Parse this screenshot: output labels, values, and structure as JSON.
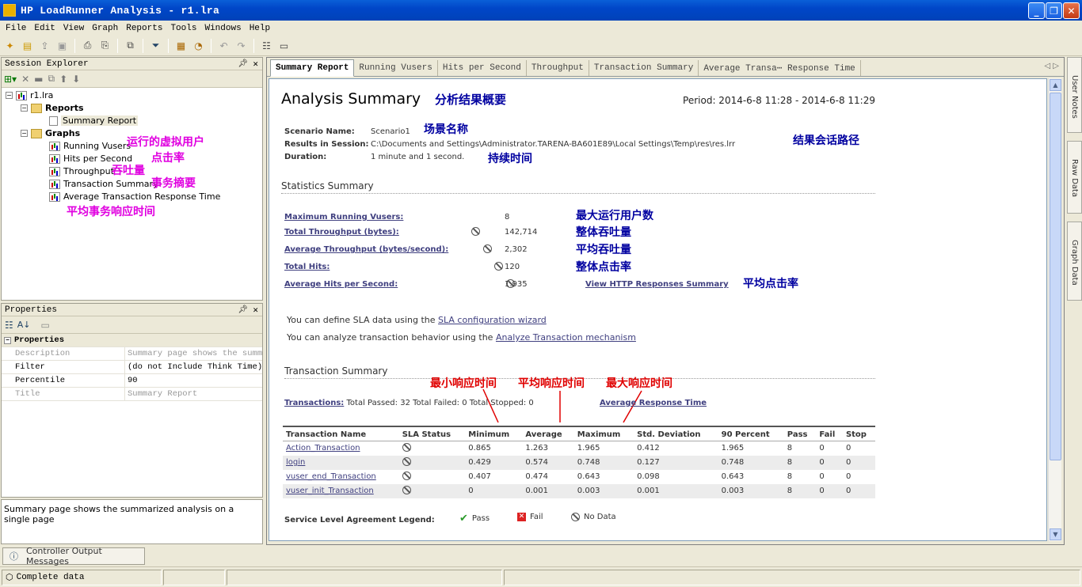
{
  "window": {
    "title": "HP LoadRunner Analysis - r1.lra"
  },
  "menu": [
    "File",
    "Edit",
    "View",
    "Graph",
    "Reports",
    "Tools",
    "Windows",
    "Help"
  ],
  "session_explorer": {
    "header": "Session Explorer",
    "root": "r1.lra",
    "reports_folder": "Reports",
    "summary_report": "Summary Report",
    "graphs_folder": "Graphs",
    "graphs": [
      "Running Vusers",
      "Hits per Second",
      "Throughput",
      "Transaction Summary",
      "Average Transaction Response Time"
    ]
  },
  "annotations_left": {
    "running_vusers": "运行的虚拟用户",
    "hits_per_second": "点击率",
    "throughput": "吞吐量",
    "transaction_summary": "事务摘要",
    "avg_response": "平均事务响应时间"
  },
  "properties": {
    "header": "Properties",
    "section": "Properties",
    "rows": [
      {
        "key": "Description",
        "value": "Summary page shows the summarized analysis on a single page",
        "disabled": true
      },
      {
        "key": "Filter",
        "value": "(do not Include Think Time)",
        "disabled": false
      },
      {
        "key": "Percentile",
        "value": "90",
        "disabled": false
      },
      {
        "key": "Title",
        "value": "Summary Report",
        "disabled": true
      }
    ],
    "description_text": "Summary page shows the summarized analysis on a single page"
  },
  "tabs": [
    "Summary Report",
    "Running Vusers",
    "Hits per Second",
    "Throughput",
    "Transaction Summary",
    "Average Transa⋯ Response Time"
  ],
  "report": {
    "title": "Analysis Summary",
    "title_annotation": "分析结果概要",
    "period": "Period: 2014-6-8 11:28 - 2014-6-8 11:29",
    "scenario_label": "Scenario Name:",
    "scenario_value": "Scenario1",
    "scenario_annotation": "场景名称",
    "results_label": "Results in Session:",
    "results_value": "C:\\Documents and Settings\\Administrator.TARENA-BA601E89\\Local Settings\\Temp\\res\\res.lrr",
    "results_annotation": "结果会话路径",
    "duration_label": "Duration:",
    "duration_value": "1 minute and 1 second.",
    "duration_annotation": "持续时间",
    "stats_title": "Statistics Summary",
    "stats": [
      {
        "label": "Maximum Running Vusers:",
        "value": "8",
        "annotation": "最大运行用户数"
      },
      {
        "label": "Total Throughput (bytes):",
        "value": "142,714",
        "annotation": "整体吞吐量"
      },
      {
        "label": "Average Throughput (bytes/second):",
        "value": "2,302",
        "annotation": "平均吞吐量"
      },
      {
        "label": "Total Hits:",
        "value": "120",
        "annotation": "整体点击率"
      },
      {
        "label": "Average Hits per Second:",
        "value": "1.935",
        "annotation": ""
      }
    ],
    "http_link": "View HTTP Responses Summary",
    "http_annotation": "平均点击率",
    "sla_text_1": "You can define SLA data using the ",
    "sla_link": "SLA configuration wizard",
    "analyze_text": "You can analyze transaction behavior using the ",
    "analyze_link": "Analyze Transaction mechanism",
    "tx_title": "Transaction Summary",
    "tx_annotations": {
      "min": "最小响应时间",
      "avg": "平均响应时间",
      "max": "最大响应时间"
    },
    "tx_link": "Transactions:",
    "tx_counts": " Total Passed: 32 Total Failed: 0 Total Stopped: 0",
    "avg_resp_link": "Average Response Time",
    "columns": [
      "Transaction Name",
      "SLA Status",
      "Minimum",
      "Average",
      "Maximum",
      "Std. Deviation",
      "90 Percent",
      "Pass",
      "Fail",
      "Stop"
    ],
    "rows": [
      [
        "Action_Transaction",
        "0.865",
        "1.263",
        "1.965",
        "0.412",
        "1.965",
        "8",
        "0",
        "0"
      ],
      [
        "login",
        "0.429",
        "0.574",
        "0.748",
        "0.127",
        "0.748",
        "8",
        "0",
        "0"
      ],
      [
        "vuser_end_Transaction",
        "0.407",
        "0.474",
        "0.643",
        "0.098",
        "0.643",
        "8",
        "0",
        "0"
      ],
      [
        "vuser_init_Transaction",
        "0",
        "0.001",
        "0.003",
        "0.001",
        "0.003",
        "8",
        "0",
        "0"
      ]
    ],
    "legend_label": "Service Level Agreement Legend:",
    "legend_pass": "Pass",
    "legend_fail": "Fail",
    "legend_nodata": "No Data"
  },
  "right_tabs": [
    "User Notes",
    "Raw Data",
    "Graph Data"
  ],
  "bottom_tab": "Controller Output Messages",
  "status": "Complete data"
}
